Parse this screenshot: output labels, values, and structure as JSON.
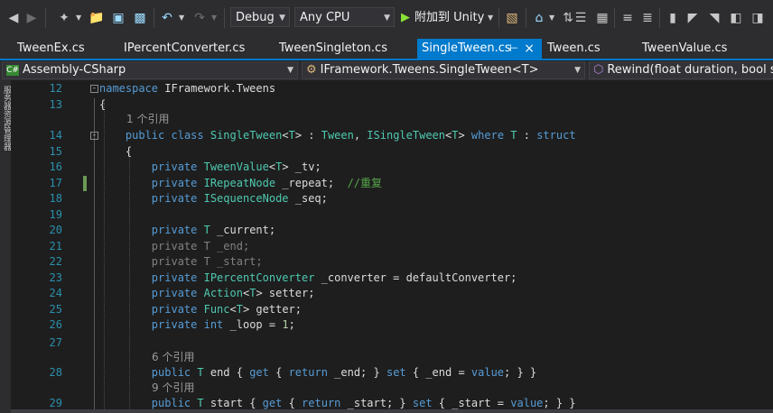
{
  "toolbar": {
    "configuration": "Debug",
    "platform": "Any CPU",
    "run_label": "附加到 Unity",
    "icons": [
      "back-icon",
      "forward-icon",
      "new-project-icon",
      "open-folder-icon",
      "save-icon",
      "save-all-icon",
      "undo-icon",
      "redo-icon",
      "play-icon",
      "attach-icon",
      "home-icon",
      "sync-icon",
      "pending-changes-icon",
      "properties-icon",
      "bookmark-icon",
      "next-bookmark-icon",
      "prev-bookmark-icon",
      "clear-bookmarks-icon"
    ]
  },
  "tabs": [
    {
      "label": "TweenEx.cs"
    },
    {
      "label": "IPercentConverter.cs"
    },
    {
      "label": "TweenSingleton.cs"
    },
    {
      "label": "SingleTween.cs",
      "active": true
    },
    {
      "label": "Tween.cs"
    },
    {
      "label": "TweenValue.cs"
    }
  ],
  "navbar": {
    "project": "Assembly-CSharp",
    "type": "IFramework.Tweens.SingleTween<T>",
    "member": "Rewind(float duration, bool sna"
  },
  "vertical_strip_text": "服务器资源管理器",
  "editor": {
    "lines": [
      {
        "num": "12",
        "text": "namespace IFramework.Tweens"
      },
      {
        "num": "13",
        "text": "{"
      },
      {
        "lens": "1 个引用"
      },
      {
        "num": "14",
        "text": "public class SingleTween<T> : Tween, ISingleTween<T> where T : struct"
      },
      {
        "num": "15",
        "text": "{"
      },
      {
        "num": "16",
        "text": "private TweenValue<T> _tv;"
      },
      {
        "num": "17",
        "text": "private IRepeatNode _repeat;  //重复"
      },
      {
        "num": "18",
        "text": "private ISequenceNode _seq;"
      },
      {
        "num": "19",
        "text": ""
      },
      {
        "num": "20",
        "text": "private T _current;"
      },
      {
        "num": "21",
        "text": "private T _end;"
      },
      {
        "num": "22",
        "text": "private T _start;"
      },
      {
        "num": "23",
        "text": "private IPercentConverter _converter = defaultConverter;"
      },
      {
        "num": "24",
        "text": "private Action<T> setter;"
      },
      {
        "num": "25",
        "text": "private Func<T> getter;"
      },
      {
        "num": "26",
        "text": "private int _loop = 1;"
      },
      {
        "num": "27",
        "text": ""
      },
      {
        "lens": "6 个引用"
      },
      {
        "num": "28",
        "text": "public T end { get { return _end; } set { _end = value; } }"
      },
      {
        "lens": "9 个引用"
      },
      {
        "num": "29",
        "text": "public T start { get { return _start; } set { _start = value; } }"
      }
    ]
  }
}
